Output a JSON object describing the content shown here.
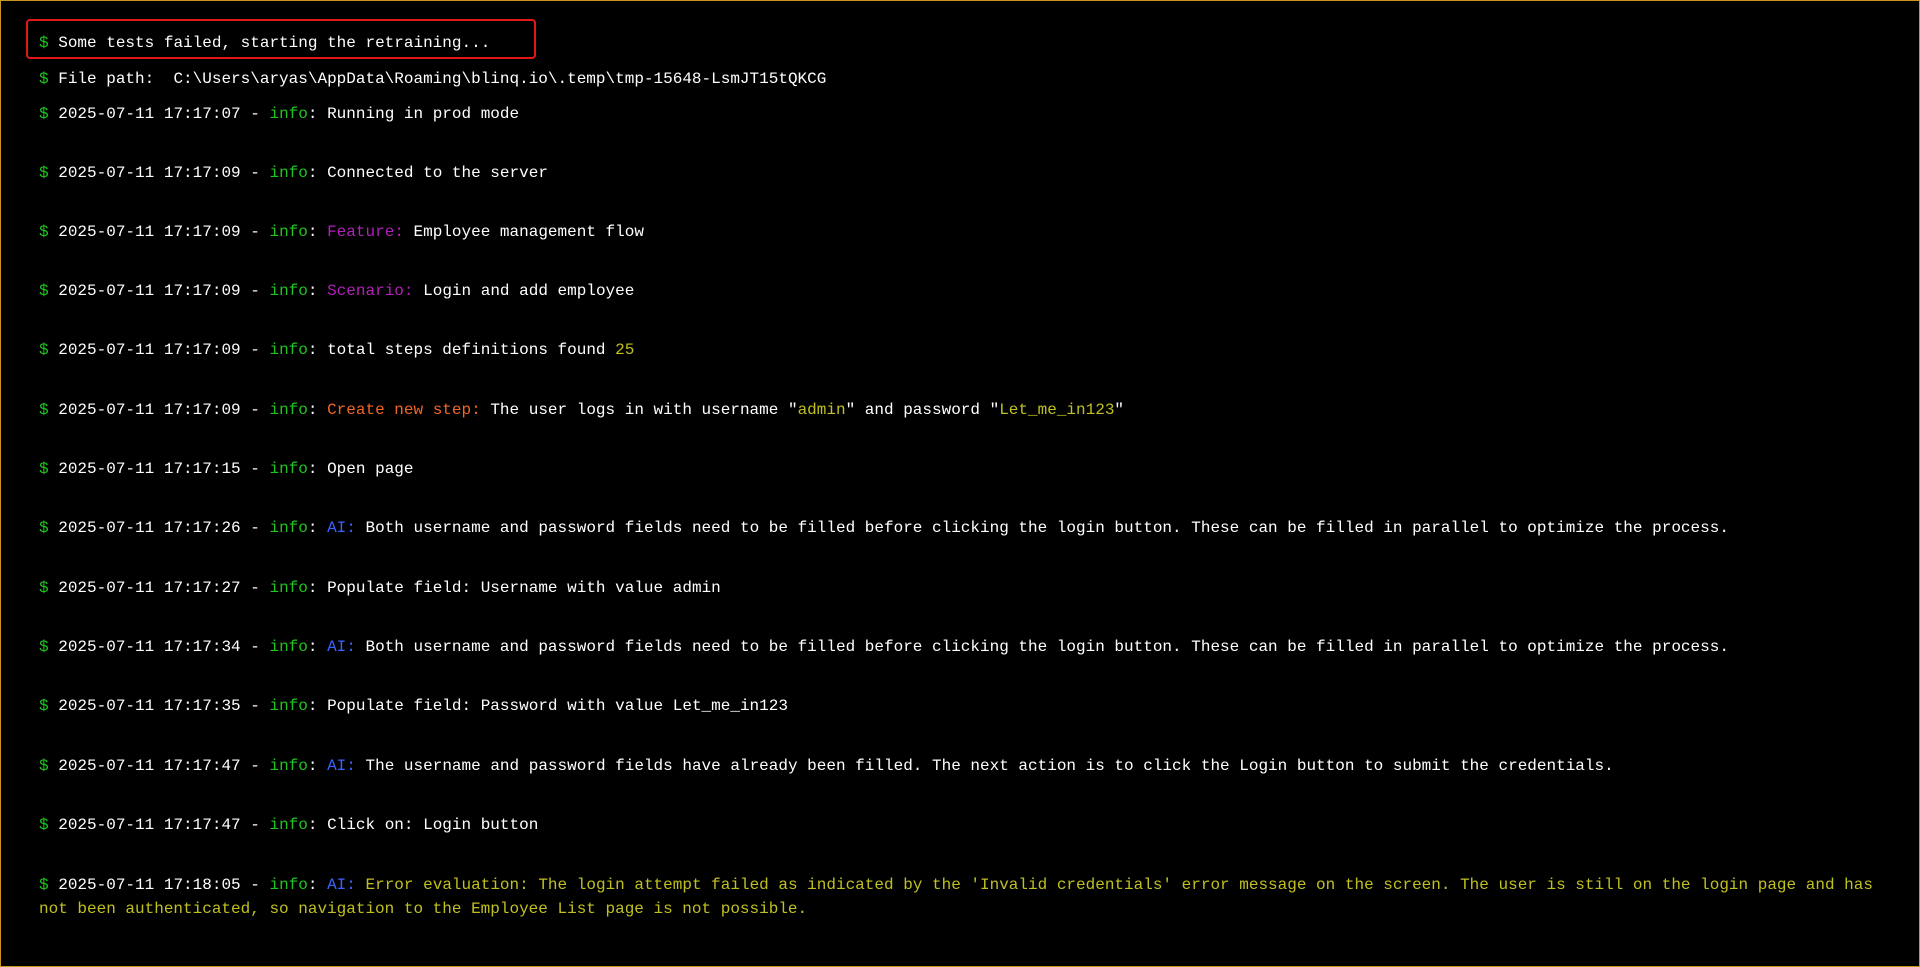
{
  "header": {
    "prompt": "$",
    "message": "Some tests failed, starting the retraining..."
  },
  "file_path": {
    "prompt": "$",
    "label": "File path:",
    "value": "C:\\Users\\aryas\\AppData\\Roaming\\blinq.io\\.temp\\tmp-15648-LsmJT15tQKCG"
  },
  "log": {
    "prompt": "$",
    "level": "info",
    "sep": " - ",
    "colon": ": ",
    "entries": [
      {
        "ts": "2025-07-11 17:17:07",
        "text": "Running in prod mode"
      },
      {
        "ts": "2025-07-11 17:17:09",
        "text": "Connected to the server"
      },
      {
        "ts": "2025-07-11 17:17:09",
        "tag": "Feature:",
        "text": "Employee management flow"
      },
      {
        "ts": "2025-07-11 17:17:09",
        "tag": "Scenario:",
        "text": "Login and add employee"
      },
      {
        "ts": "2025-07-11 17:17:09",
        "text": "total steps definitions found ",
        "count": "25"
      },
      {
        "ts": "2025-07-11 17:17:09",
        "tag": "Create new step:",
        "text_a": "The user logs in with username \"",
        "val_a": "admin",
        "text_b": "\" and password \"",
        "val_b": "Let_me_in123",
        "text_c": "\""
      },
      {
        "ts": "2025-07-11 17:17:15",
        "text": "Open page"
      },
      {
        "ts": "2025-07-11 17:17:26",
        "tag": "AI:",
        "text": "Both username and password fields need to be filled before clicking the login button. These can be filled in parallel to optimize the process."
      },
      {
        "ts": "2025-07-11 17:17:27",
        "text": "Populate field: Username with value admin"
      },
      {
        "ts": "2025-07-11 17:17:34",
        "tag": "AI:",
        "text": "Both username and password fields need to be filled before clicking the login button. These can be filled in parallel to optimize the process."
      },
      {
        "ts": "2025-07-11 17:17:35",
        "text": "Populate field: Password with value Let_me_in123"
      },
      {
        "ts": "2025-07-11 17:17:47",
        "tag": "AI:",
        "text": "The username and password fields have already been filled. The next action is to click the Login button to submit the credentials."
      },
      {
        "ts": "2025-07-11 17:17:47",
        "text": "Click on: Login button"
      },
      {
        "ts": "2025-07-11 17:18:05",
        "tag": "AI:",
        "text": "Error evaluation: The login attempt failed as indicated by the 'Invalid credentials' error message on the screen. The user is still on the login page and has not been authenticated, so navigation to the Employee List page is not possible."
      }
    ]
  },
  "colors": {
    "background": "#000000",
    "border": "#c8961e",
    "highlight_box": "#e01818",
    "prompt": "#1fc41f",
    "info": "#1fc41f",
    "feature_tag": "#b020b8",
    "create_step_tag": "#f26522",
    "ai_tag": "#3b64ff",
    "value": "#c0c020",
    "text": "#ffffff"
  }
}
